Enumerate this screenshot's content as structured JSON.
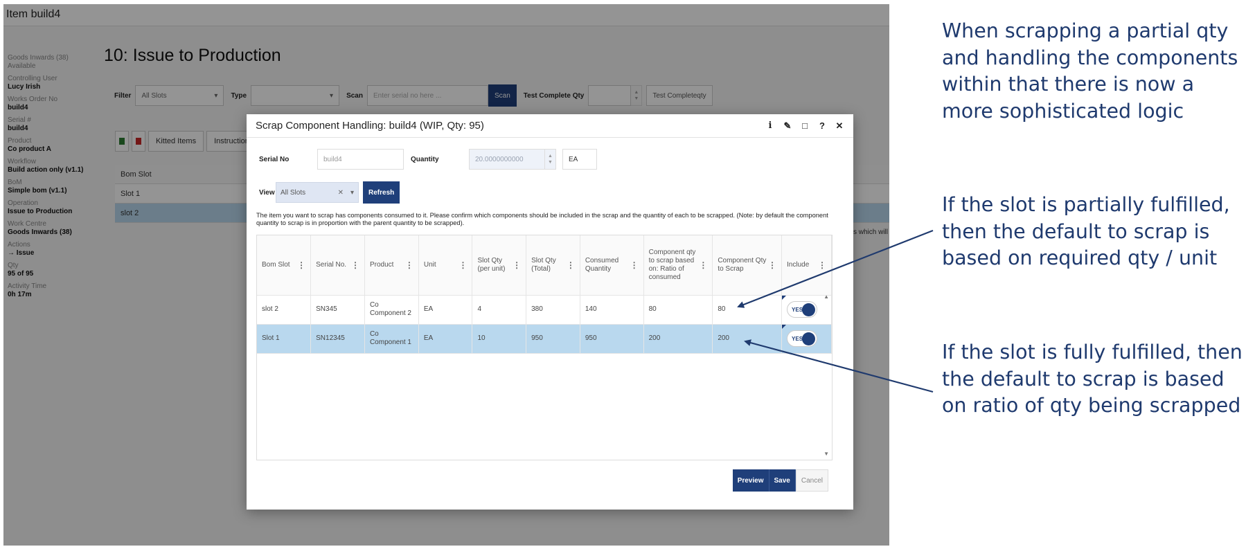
{
  "app": {
    "window_title": "Item build4",
    "page_title": "10: Issue to Production",
    "details": [
      {
        "label": "Goods Inwards (38)",
        "value": "Available",
        "style": "sub"
      },
      {
        "label": "Controlling User",
        "value": "Lucy Irish"
      },
      {
        "label": "Works Order No",
        "value": "build4"
      },
      {
        "label": "Serial #",
        "value": "build4"
      },
      {
        "label": "Product",
        "value": "Co product A"
      },
      {
        "label": "Workflow",
        "value": "Build action only (v1.1)"
      },
      {
        "label": "BoM",
        "value": "Simple bom (v1.1)"
      },
      {
        "label": "Operation",
        "value": "Issue to Production"
      },
      {
        "label": "Work Centre",
        "value": "Goods Inwards (38)"
      },
      {
        "label": "Actions",
        "value": "→ Issue"
      },
      {
        "label": "Qty",
        "value": "95 of 95"
      },
      {
        "label": "Activity Time",
        "value": "0h 17m"
      }
    ],
    "filter_bar": {
      "filter_label": "Filter",
      "filter_value": "All Slots",
      "type_label": "Type",
      "scan_label": "Scan",
      "scan_placeholder": "Enter serial no here ...",
      "scan_button": "Scan",
      "test_complete_label": "Test Complete Qty",
      "test_complete_button": "Test Completeqty"
    },
    "toolbar": {
      "kitted_items": "Kitted Items",
      "instructions": "Instructions"
    },
    "bg_grid": {
      "header": "Bom Slot",
      "rows": [
        "Slot 1",
        "slot 2"
      ],
      "row_tail": "s which will"
    }
  },
  "modal": {
    "title": "Scrap Component Handling: build4 (WIP, Qty: 95)",
    "header_icons": [
      "info-icon",
      "edit-icon",
      "maximize-icon",
      "help-icon",
      "close-icon"
    ],
    "serial_no_label": "Serial No",
    "serial_no_value": "build4",
    "quantity_label": "Quantity",
    "quantity_value": "20.0000000000",
    "unit_value": "EA",
    "view_label": "View",
    "view_value": "All Slots",
    "refresh_button": "Refresh",
    "info_text": "The item you want to scrap has components consumed to it. Please confirm which components should be included in the scrap and the quantity of each to be scrapped. (Note: by default the component quantity to scrap is in proportion with the parent quantity to be scrapped).",
    "grid": {
      "columns": [
        "Bom Slot",
        "Serial No.",
        "Product",
        "Unit",
        "Slot Qty (per unit)",
        "Slot Qty (Total)",
        "Consumed Quantity",
        "Component qty to scrap based on: Ratio of consumed",
        "Component Qty to Scrap",
        "Include"
      ],
      "rows": [
        {
          "bom_slot": "slot 2",
          "serial": "SN345",
          "product": "Co Component 2",
          "unit": "EA",
          "qty_per_unit": "4",
          "qty_total": "380",
          "consumed": "140",
          "ratio_qty": "80",
          "qty_to_scrap": "80",
          "include": "YES",
          "selected": false
        },
        {
          "bom_slot": "Slot 1",
          "serial": "SN12345",
          "product": "Co Component 1",
          "unit": "EA",
          "qty_per_unit": "10",
          "qty_total": "950",
          "consumed": "950",
          "ratio_qty": "200",
          "qty_to_scrap": "200",
          "include": "YES",
          "selected": true
        }
      ]
    },
    "footer": {
      "preview": "Preview",
      "save": "Save",
      "cancel": "Cancel"
    }
  },
  "annotations": [
    "When scrapping a partial qty and handling the components within that there is now a more sophisticated logic",
    "If the slot is partially fulfilled, then the default to scrap is based on required qty / unit",
    "If the slot is fully fulfilled, then the default to scrap is based on ratio of qty being scrapped"
  ],
  "colors": {
    "accent": "#1f3f7a",
    "selected_row": "#b9d8ee",
    "annotation_text": "#1f3a6e"
  }
}
